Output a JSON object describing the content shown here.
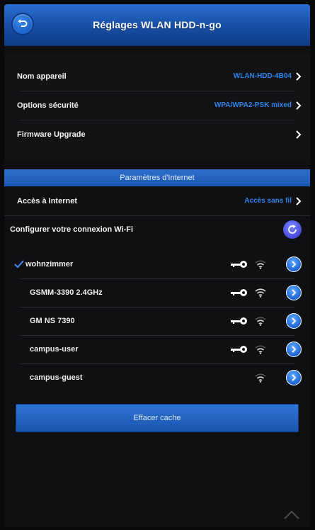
{
  "header": {
    "title": "Réglages WLAN HDD-n-go"
  },
  "settings": [
    {
      "label": "Nom appareil",
      "value": "WLAN-HDD-4B04"
    },
    {
      "label": "Options sécurité",
      "value": "WPA/WPA2-PSK mixed"
    },
    {
      "label": "Firmware Upgrade",
      "value": ""
    }
  ],
  "internet": {
    "section_title": "Paramètres d'Internet",
    "access_label": "Accès à Internet",
    "access_value": "Accès sans fil",
    "configure_label": "Configurer votre connexion Wi-Fi"
  },
  "networks": [
    {
      "name": "wohnzimmer",
      "connected": true,
      "secured": true,
      "signal": "weak"
    },
    {
      "name": "GSMM-3390 2.4GHz",
      "connected": false,
      "secured": true,
      "signal": "strong"
    },
    {
      "name": "GM NS 7390",
      "connected": false,
      "secured": true,
      "signal": "weak"
    },
    {
      "name": "campus-user",
      "connected": false,
      "secured": true,
      "signal": "weak"
    },
    {
      "name": "campus-guest",
      "connected": false,
      "secured": false,
      "signal": "weak"
    }
  ],
  "clear_cache_label": "Effacer cache",
  "colors": {
    "accent": "#1f63c4",
    "link": "#2c83ea",
    "background": "#131316"
  }
}
